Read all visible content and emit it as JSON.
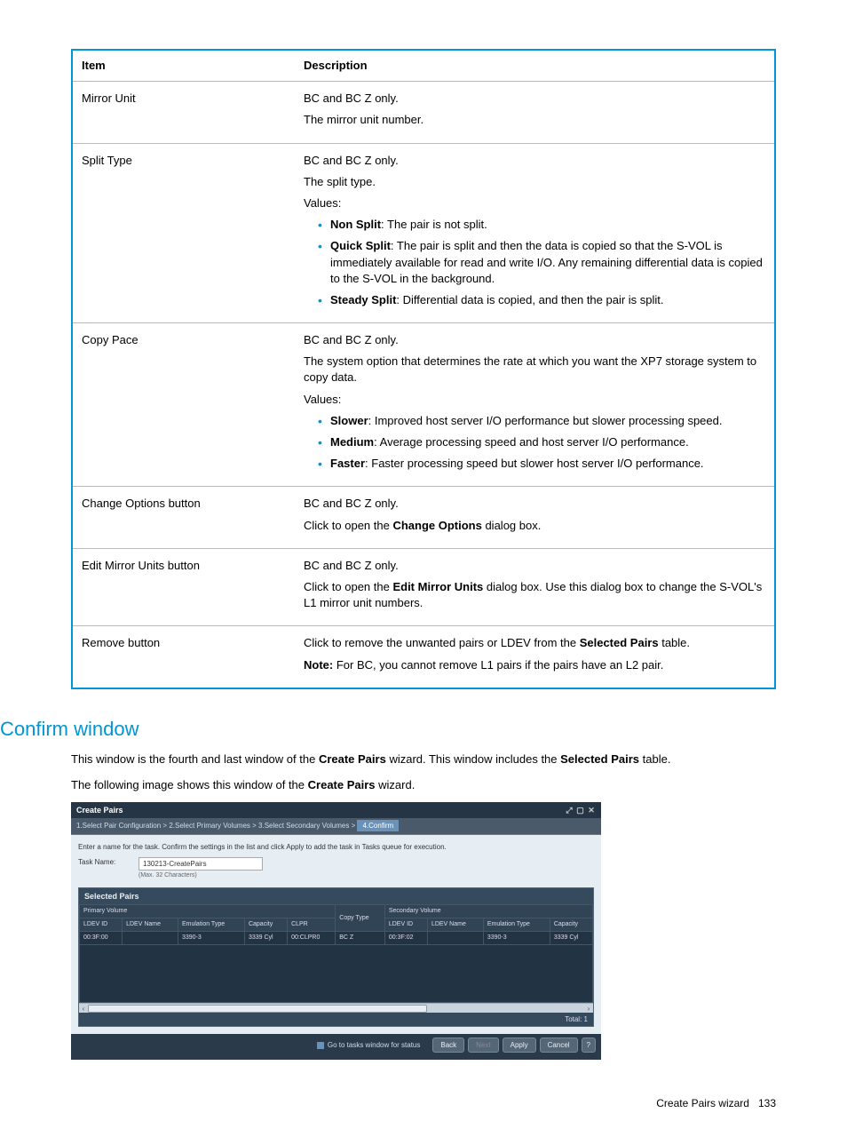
{
  "table": {
    "headers": {
      "item": "Item",
      "description": "Description"
    },
    "rows": [
      {
        "item": "Mirror Unit",
        "desc": {
          "lines": [
            "BC and BC Z only.",
            "The mirror unit number."
          ]
        }
      },
      {
        "item": "Split Type",
        "desc": {
          "lines": [
            "BC and BC Z only.",
            "The split type.",
            "Values:"
          ],
          "bullets": [
            {
              "bold": "Non Split",
              "text": ": The pair is not split."
            },
            {
              "bold": "Quick Split",
              "text": ": The pair is split and then the data is copied so that the S-VOL is immediately available for read and write I/O. Any remaining differential data is copied to the S-VOL in the background."
            },
            {
              "bold": "Steady Split",
              "text": ": Differential data is copied, and then the pair is split."
            }
          ]
        }
      },
      {
        "item": "Copy Pace",
        "desc": {
          "lines": [
            "BC and BC Z only.",
            "The system option that determines the rate at which you want the XP7 storage system to copy data.",
            "Values:"
          ],
          "bullets": [
            {
              "bold": "Slower",
              "text": ": Improved host server I/O performance but slower processing speed."
            },
            {
              "bold": "Medium",
              "text": ": Average processing speed and host server I/O performance."
            },
            {
              "bold": "Faster",
              "text": ": Faster processing speed but slower host server I/O performance."
            }
          ]
        }
      },
      {
        "item": "Change Options button",
        "desc": {
          "lines_rich": [
            {
              "text": "BC and BC Z only."
            },
            {
              "pre": "Click to open the ",
              "bold": "Change Options",
              "post": " dialog box."
            }
          ]
        }
      },
      {
        "item": "Edit Mirror Units button",
        "desc": {
          "lines_rich": [
            {
              "text": "BC and BC Z only."
            },
            {
              "pre": "Click to open the ",
              "bold": "Edit Mirror Units",
              "post": " dialog box. Use this dialog box to change the S-VOL's L1 mirror unit numbers."
            }
          ]
        }
      },
      {
        "item": "Remove button",
        "desc": {
          "lines_rich": [
            {
              "pre": "Click to remove the unwanted pairs or LDEV from the ",
              "bold": "Selected Pairs",
              "post": " table."
            },
            {
              "pre": "",
              "bold": "Note:",
              "post": " For BC, you cannot remove L1 pairs if the pairs have an L2 pair."
            }
          ]
        }
      }
    ]
  },
  "section": {
    "heading": "Confirm window",
    "para1_pre": "This window is the fourth and last window of the ",
    "para1_bold1": "Create Pairs",
    "para1_mid": " wizard. This window includes the ",
    "para1_bold2": "Selected Pairs",
    "para1_post": " table.",
    "para2_pre": "The following image shows this window of the ",
    "para2_bold": "Create Pairs",
    "para2_post": " wizard."
  },
  "screenshot": {
    "title": "Create Pairs",
    "breadcrumb": {
      "steps": [
        "1.Select Pair Configuration",
        "2.Select Primary Volumes",
        "3.Select Secondary Volumes"
      ],
      "active": "4.Confirm",
      "sep": ">"
    },
    "instruction": "Enter a name for the task. Confirm the settings in the list and click Apply to add the task in Tasks queue for execution.",
    "task_label": "Task Name:",
    "task_value": "130213-CreatePairs",
    "task_hint": "(Max. 32 Characters)",
    "panel_title": "Selected Pairs",
    "grid": {
      "group_primary": "Primary Volume",
      "group_copy": "Copy Type",
      "group_secondary": "Secondary Volume",
      "cols_primary": [
        "LDEV ID",
        "LDEV Name",
        "Emulation Type",
        "Capacity",
        "CLPR"
      ],
      "cols_secondary": [
        "LDEV ID",
        "LDEV Name",
        "Emulation Type",
        "Capacity"
      ],
      "row": {
        "p_ldev_id": "00:3F:00",
        "p_ldev_name": "",
        "p_emul": "3390-3",
        "p_cap": "3339 Cyl",
        "p_clpr": "00:CLPR0",
        "copy_type": "BC Z",
        "s_ldev_id": "00:3F:02",
        "s_ldev_name": "",
        "s_emul": "3390-3",
        "s_cap": "3339 Cyl"
      }
    },
    "total_label": "Total:",
    "total_value": "1",
    "footer": {
      "checkbox": "Go to tasks window for status",
      "back": "Back",
      "next": "Next",
      "apply": "Apply",
      "cancel": "Cancel",
      "help": "?"
    }
  },
  "page_footer": {
    "text": "Create Pairs wizard",
    "page": "133"
  }
}
